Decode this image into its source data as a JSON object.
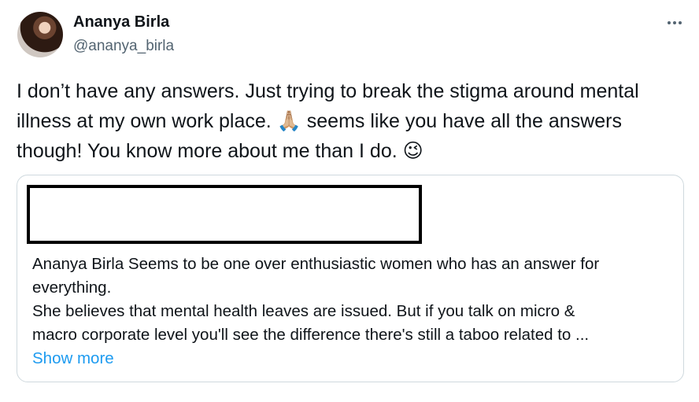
{
  "author": {
    "name": "Ananya Birla",
    "handle": "@ananya_birla"
  },
  "more_icon": "more-horizontal-icon",
  "tweet": {
    "line1": "I don’t have any answers. Just trying to break the stigma around mental",
    "line2_a": "illness at my own work place.",
    "emoji_pray": "🙏🏼",
    "line2_b": "seems like you have all the answers",
    "line3": "though! You know more about me than I do.",
    "emoji_wink": "😉"
  },
  "quote": {
    "line1": "Ananya Birla Seems to be one over enthusiastic women who has an answer for",
    "line2": "everything.",
    "line3": "She believes that mental health leaves are issued. But if you talk on micro &",
    "line4": "macro corporate level you'll see the difference there's still a taboo related to ...",
    "show_more": "Show more"
  },
  "colors": {
    "text": "#0f1419",
    "secondary": "#536471",
    "link": "#1d9bf0",
    "border": "#cfd9de"
  }
}
